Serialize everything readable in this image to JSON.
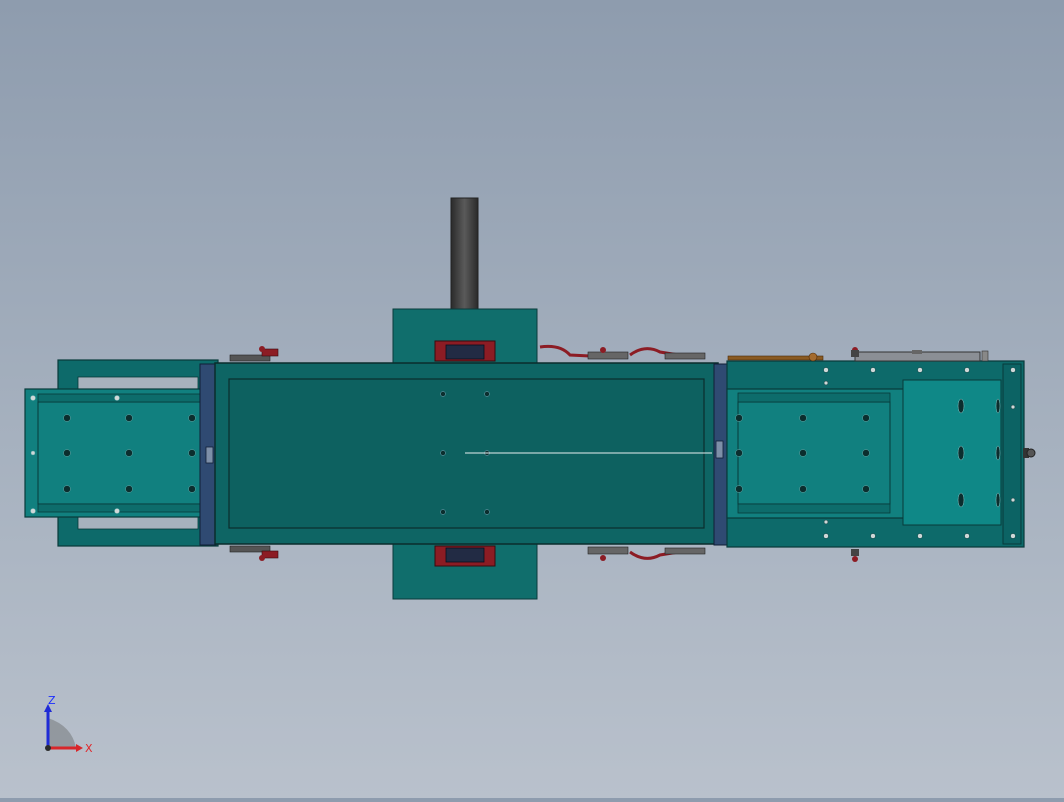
{
  "viewport": {
    "background_top": "#8e9cae",
    "background_bottom": "#b9c1cc"
  },
  "model": {
    "description_color_body": "#0e6b6a",
    "accent_teal": "#137f7e",
    "clamp_color": "#8c1c24",
    "post_color": "#3a3a3a"
  },
  "triad": {
    "z_label": "Z",
    "x_label": "X",
    "z_color": "#1f2bd6",
    "x_color": "#d8262a"
  }
}
